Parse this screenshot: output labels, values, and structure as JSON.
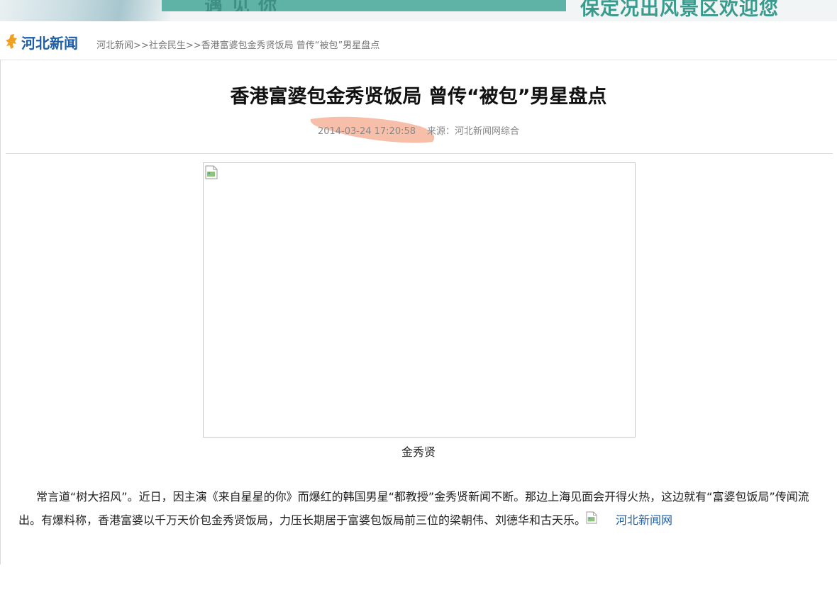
{
  "banner": {
    "left_text": "遇见你",
    "slogan": "保定况出风景区欢迎您",
    "colors": {
      "teal": "#5fb3a6",
      "slogan": "#3a9a8c"
    }
  },
  "site": {
    "logo_text": "河北新闻",
    "logo_icon": "hebei-map-icon",
    "brand_color": "#1d5ea8"
  },
  "breadcrumb": {
    "items": [
      "河北新闻",
      "社会民生",
      "香港富婆包金秀贤饭局 曾传“被包”男星盘点"
    ],
    "separator": ">>"
  },
  "article": {
    "title": "香港富婆包金秀贤饭局 曾传“被包”男星盘点",
    "datetime": "2014-03-24 17:20:58",
    "source_label": "来源：",
    "source": "河北新闻网综合",
    "image_caption": "金秀贤",
    "paragraph": "常言道“树大招风”。近日，因主演《来自星星的你》而爆红的韩国男星“都教授”金秀贤新闻不断。那边上海见面会开得火热，这边就有“富婆包饭局”传闻流出。有爆料称，香港富婆以千万天价包金秀贤饭局，力压长期居于富婆包饭局前三位的梁朝伟、刘德华和古天乐。",
    "inline_image_alt": "河北新闻网"
  },
  "annotation": {
    "highlight_color": "#f4a98c"
  }
}
